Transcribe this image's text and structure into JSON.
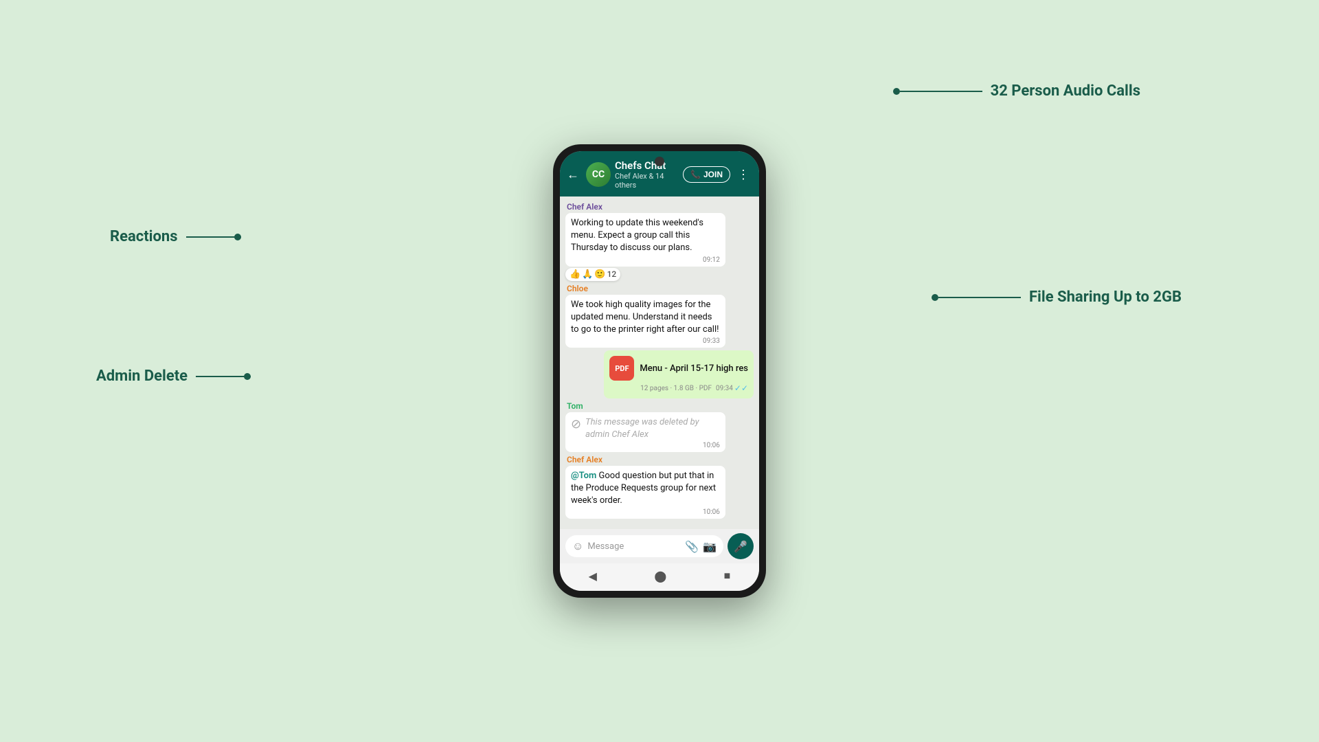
{
  "background_color": "#d9edd9",
  "annotations": {
    "reactions": "Reactions",
    "admin_delete": "Admin Delete",
    "audio_calls": "32 Person Audio Calls",
    "file_sharing": "File Sharing Up to 2GB"
  },
  "phone": {
    "header": {
      "back_icon": "←",
      "avatar_initials": "CC",
      "group_name": "Chefs Chat",
      "group_sub": "Chef Alex & 14 others",
      "join_label": "JOIN",
      "more_icon": "⋮"
    },
    "messages": [
      {
        "type": "incoming",
        "sender": "Chef Alex",
        "sender_color": "#6b4c9a",
        "text": "Working to update this weekend's menu. Expect a group call this Thursday to discuss our plans.",
        "time": "09:12",
        "reactions": [
          "👍",
          "🙏",
          "🙂",
          "12"
        ]
      },
      {
        "type": "incoming",
        "sender": "Chloe",
        "sender_color": "#e67e22",
        "text": "We took high quality images for the updated menu. Understand it needs to go to the printer right after our call!",
        "time": "09:33"
      },
      {
        "type": "outgoing",
        "pdf_name": "Menu - April 15-17 high res",
        "pdf_pages": "12 pages",
        "pdf_size": "1.8 GB",
        "pdf_type": "PDF",
        "time": "09:34",
        "ticks": "✓✓"
      },
      {
        "type": "incoming",
        "sender": "Tom",
        "sender_color": "#27ae60",
        "deleted": true,
        "deleted_text": "This message was deleted by admin Chef Alex",
        "time": "10:06"
      },
      {
        "type": "incoming",
        "sender": "Chef Alex",
        "sender_color": "#e67e22",
        "mention": "@Tom",
        "text": " Good question but put that in the Produce Requests group for next week's order.",
        "time": "10:06"
      }
    ],
    "input_bar": {
      "emoji_icon": "☺",
      "placeholder": "Message",
      "attach_icon": "📎",
      "camera_icon": "📷",
      "mic_icon": "🎤"
    },
    "nav": {
      "back": "◀",
      "home": "⬤",
      "square": "■"
    }
  }
}
